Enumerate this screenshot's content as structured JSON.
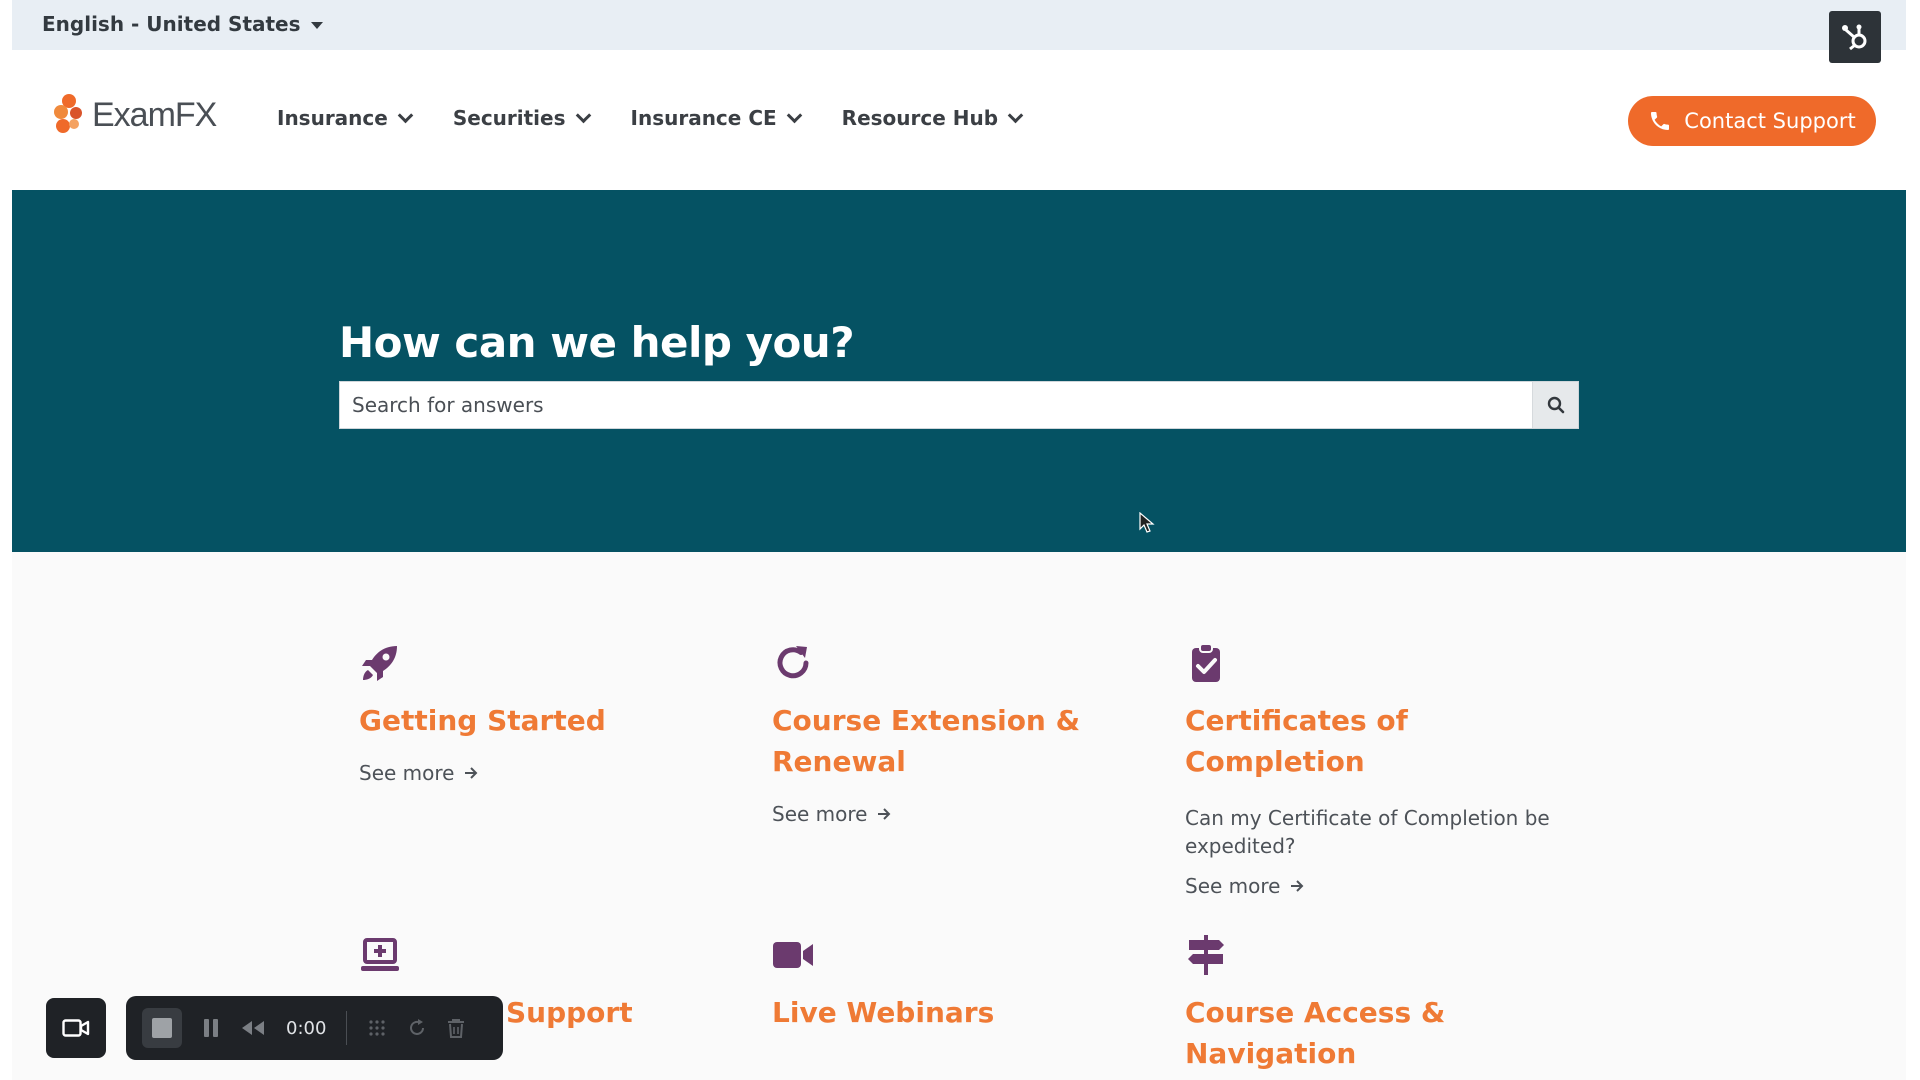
{
  "language": {
    "label": "English - United States"
  },
  "header": {
    "logo_text": "ExamFX",
    "nav": [
      {
        "label": "Insurance"
      },
      {
        "label": "Securities"
      },
      {
        "label": "Insurance CE"
      },
      {
        "label": "Resource Hub"
      }
    ],
    "contact_label": "Contact Support"
  },
  "hero": {
    "title": "How can we help you?",
    "search_placeholder": "Search for answers"
  },
  "cards": [
    {
      "icon": "rocket-icon",
      "title": "Getting Started",
      "desc": "",
      "see_more": "See more"
    },
    {
      "icon": "refresh-icon",
      "title": "Course Extension & Renewal",
      "desc": "",
      "see_more": "See more"
    },
    {
      "icon": "clipboard-check-icon",
      "title": "Certificates of Completion",
      "desc": "Can my Certificate of Completion be expedited?",
      "see_more": "See more"
    },
    {
      "icon": "laptop-plus-icon",
      "title": "Support",
      "desc": "",
      "see_more": ""
    },
    {
      "icon": "video-camera-icon",
      "title": "Live Webinars",
      "desc": "",
      "see_more": ""
    },
    {
      "icon": "signpost-icon",
      "title": "Course Access & Navigation",
      "desc": "",
      "see_more": ""
    }
  ],
  "recorder": {
    "time": "0:00"
  },
  "colors": {
    "teal": "#055263",
    "orange": "#ef6a2a",
    "accent_title": "#ef7a35",
    "icon_purple": "#6b3a6e"
  }
}
